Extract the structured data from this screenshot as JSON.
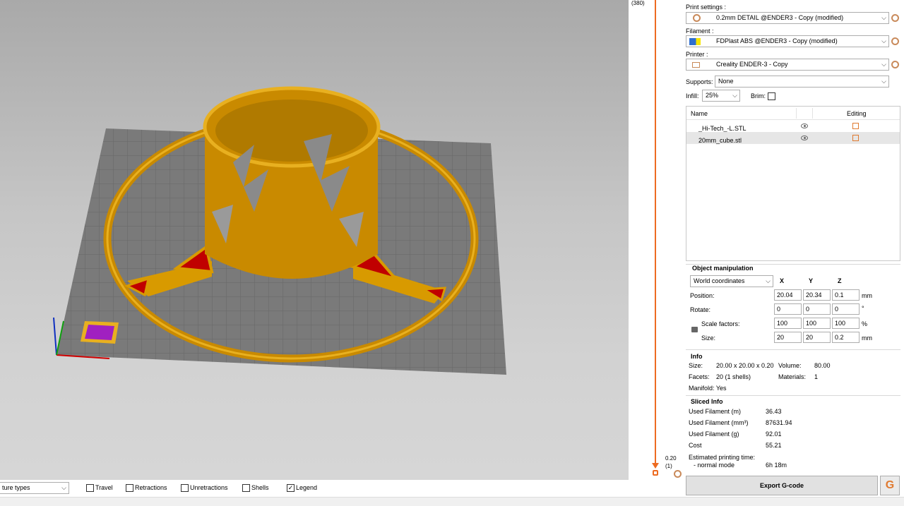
{
  "slider": {
    "top_value": "(380)",
    "bottom_value": "0.20",
    "bottom_layer": "(1)"
  },
  "print_settings": {
    "label": "Print settings :",
    "value": "0.2mm DETAIL @ENDER3 - Copy (modified)"
  },
  "filament": {
    "label": "Filament :",
    "value": "FDPlast ABS @ENDER3 - Copy (modified)"
  },
  "printer": {
    "label": "Printer :",
    "value": "Creality ENDER-3 - Copy"
  },
  "supports": {
    "label": "Supports:",
    "value": "None"
  },
  "infill": {
    "label": "Infill:",
    "value": "25%"
  },
  "brim": {
    "label": "Brim:"
  },
  "object_list": {
    "col_name": "Name",
    "col_editing": "Editing",
    "items": [
      {
        "name": "_Hi-Tech_-L.STL"
      },
      {
        "name": "20mm_cube.stl"
      }
    ]
  },
  "object_manipulation": {
    "title": "Object manipulation",
    "coords": "World coordinates",
    "col_x": "X",
    "col_y": "Y",
    "col_z": "Z",
    "position": {
      "label": "Position:",
      "x": "20.04",
      "y": "20.34",
      "z": "0.1",
      "unit": "mm"
    },
    "rotate": {
      "label": "Rotate:",
      "x": "0",
      "y": "0",
      "z": "0",
      "unit": "°"
    },
    "scale": {
      "label": "Scale factors:",
      "x": "100",
      "y": "100",
      "z": "100",
      "unit": "%"
    },
    "size": {
      "label": "Size:",
      "x": "20",
      "y": "20",
      "z": "0.2",
      "unit": "mm"
    }
  },
  "info": {
    "title": "Info",
    "size_label": "Size:",
    "size_value": "20.00 x 20.00 x 0.20",
    "volume_label": "Volume:",
    "volume_value": "80.00",
    "facets_label": "Facets:",
    "facets_value": "20 (1 shells)",
    "materials_label": "Materials:",
    "materials_value": "1",
    "manifold": "Manifold: Yes"
  },
  "sliced_info": {
    "title": "Sliced Info",
    "rows": [
      {
        "label": "Used Filament (m)",
        "value": "36.43"
      },
      {
        "label": "Used Filament (mm³)",
        "value": "87631.94"
      },
      {
        "label": "Used Filament (g)",
        "value": "92.01"
      },
      {
        "label": "Cost",
        "value": "55.21"
      }
    ],
    "time_label": "Estimated printing time:",
    "mode_label": "- normal mode",
    "mode_value": "6h 18m"
  },
  "bottom": {
    "view_type": "ture types",
    "options": [
      {
        "label": "Travel",
        "checked": false
      },
      {
        "label": "Retractions",
        "checked": false
      },
      {
        "label": "Unretractions",
        "checked": false
      },
      {
        "label": "Shells",
        "checked": false
      },
      {
        "label": "Legend",
        "checked": true
      }
    ]
  },
  "export": {
    "label": "Export G-code",
    "icon_glyph": "G"
  },
  "colors": {
    "accent": "#ed6b21",
    "print": "#d89a00",
    "support": "#c00000",
    "bed": "#7f7f7f"
  }
}
